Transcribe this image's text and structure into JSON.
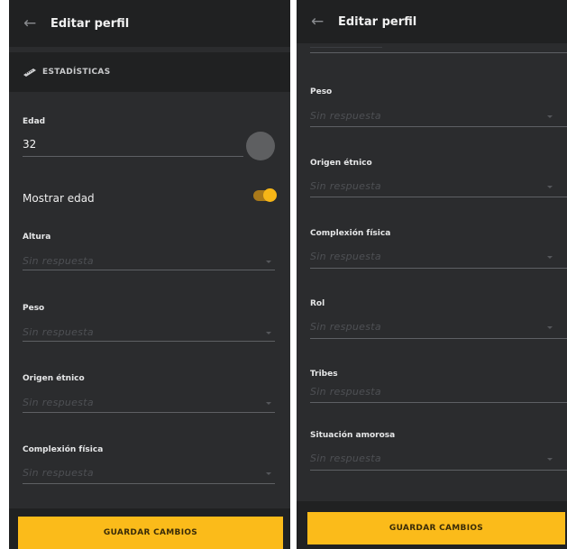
{
  "left_screen": {
    "header": {
      "title": "Editar perfil",
      "back_icon": "arrow-left-icon"
    },
    "section": {
      "icon": "ruler-icon",
      "title": "ESTADÍSTICAS"
    },
    "age": {
      "label": "Edad",
      "value": "32"
    },
    "show_age": {
      "label": "Mostrar edad",
      "enabled": true
    },
    "fields": [
      {
        "label": "Altura",
        "placeholder": "Sin respuesta"
      },
      {
        "label": "Peso",
        "placeholder": "Sin respuesta"
      },
      {
        "label": "Origen étnico",
        "placeholder": "Sin respuesta"
      },
      {
        "label": "Complexión física",
        "placeholder": "Sin respuesta"
      }
    ],
    "save_label": "GUARDAR CAMBIOS"
  },
  "right_screen": {
    "header": {
      "title": "Editar perfil",
      "back_icon": "arrow-left-icon"
    },
    "fields": [
      {
        "label": "Peso",
        "placeholder": "Sin respuesta"
      },
      {
        "label": "Origen étnico",
        "placeholder": "Sin respuesta"
      },
      {
        "label": "Complexión física",
        "placeholder": "Sin respuesta"
      },
      {
        "label": "Rol",
        "placeholder": "Sin respuesta"
      },
      {
        "label": "Tribes",
        "placeholder": "Sin respuesta"
      },
      {
        "label": "Situación amorosa",
        "placeholder": "Sin respuesta"
      }
    ],
    "save_label": "GUARDAR CAMBIOS"
  },
  "colors": {
    "background": "#2b2c2e",
    "header_bg": "#202122",
    "accent": "#fbbb1a",
    "placeholder": "#4e5054"
  }
}
